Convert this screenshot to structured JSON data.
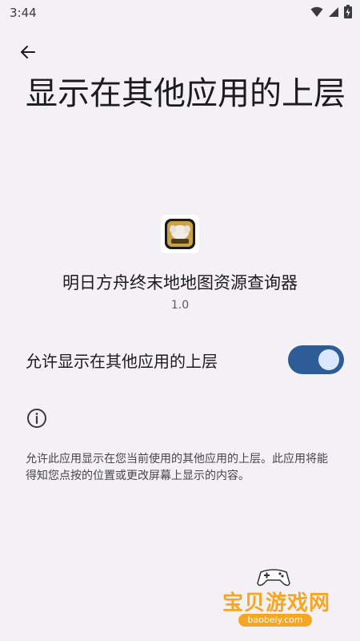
{
  "status_bar": {
    "time": "3:44"
  },
  "header": {
    "title": "显示在其他应用的上层"
  },
  "app": {
    "name": "明日方舟终末地地图资源查询器",
    "version": "1.0",
    "icon": "app-icon-image"
  },
  "setting": {
    "label": "允许显示在其他应用的上层",
    "enabled": true
  },
  "info": {
    "description": "允许此应用显示在您当前使用的其他应用的上层。此应用将能得知您点按的位置或更改屏幕上显示的内容。"
  },
  "watermark": {
    "text": "宝贝游戏网",
    "url": "baobeiy.com"
  },
  "colors": {
    "background": "#f3f1f6",
    "switch_track": "#2d5c96",
    "switch_thumb": "#dbe6ff",
    "watermark": "#f5a623"
  }
}
